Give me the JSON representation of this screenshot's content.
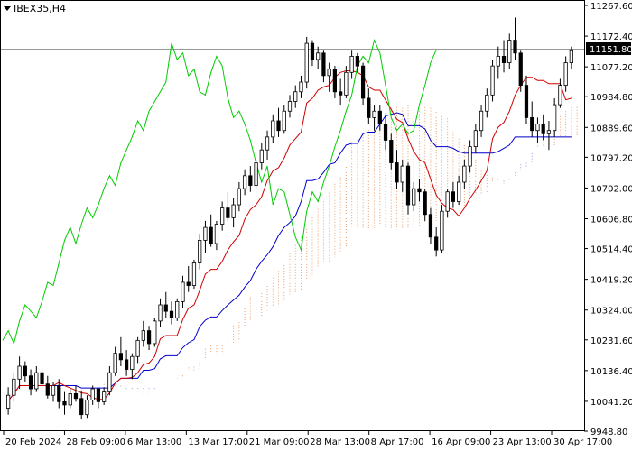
{
  "symbol": {
    "label": "IBEX35,H4"
  },
  "current_price_label": "11151.80",
  "chart_data": {
    "type": "candlestick",
    "title": "",
    "y_ticks": [
      "9948.80",
      "10041.20",
      "10136.40",
      "10231.60",
      "10324.00",
      "10419.20",
      "10514.40",
      "10606.80",
      "10702.00",
      "10797.20",
      "10889.60",
      "10984.80",
      "11077.20",
      "11172.40",
      "11267.60"
    ],
    "ylim": [
      9948.8,
      11267.6
    ],
    "x_ticks": [
      "20 Feb 2024",
      "28 Feb 09:00",
      "6 Mar 13:00",
      "13 Mar 17:00",
      "21 Mar 09:00",
      "28 Mar 13:00",
      "8 Apr 17:00",
      "16 Apr 09:00",
      "23 Apr 13:00",
      "30 Apr 17:00"
    ],
    "grid": false,
    "colors": {
      "bull": "#ffffff",
      "bear": "#000000",
      "wick": "#000000",
      "tenkan": "#d00000",
      "kijun": "#0000cc",
      "chikou": "#00cc00",
      "cloud_up": "#e8a070",
      "cloud_down": "#a0a0e0"
    },
    "candles": [
      [
        10020,
        10085,
        10000,
        10060
      ],
      [
        10060,
        10130,
        10040,
        10110
      ],
      [
        10110,
        10180,
        10080,
        10150
      ],
      [
        10150,
        10165,
        10100,
        10120
      ],
      [
        10120,
        10140,
        10060,
        10080
      ],
      [
        10080,
        10150,
        10070,
        10130
      ],
      [
        10130,
        10145,
        10080,
        10095
      ],
      [
        10095,
        10120,
        10050,
        10060
      ],
      [
        10060,
        10100,
        10040,
        10090
      ],
      [
        10090,
        10110,
        10020,
        10040
      ],
      [
        10040,
        10070,
        10000,
        10030
      ],
      [
        10030,
        10080,
        10020,
        10065
      ],
      [
        10065,
        10090,
        10040,
        10050
      ],
      [
        10050,
        10075,
        9985,
        10000
      ],
      [
        10000,
        10060,
        9990,
        10045
      ],
      [
        10045,
        10090,
        10030,
        10080
      ],
      [
        10080,
        10070,
        10020,
        10040
      ],
      [
        10040,
        10085,
        10030,
        10070
      ],
      [
        10070,
        10150,
        10060,
        10130
      ],
      [
        10130,
        10210,
        10120,
        10190
      ],
      [
        10190,
        10240,
        10150,
        10170
      ],
      [
        10170,
        10200,
        10120,
        10140
      ],
      [
        10140,
        10190,
        10110,
        10180
      ],
      [
        10180,
        10240,
        10160,
        10230
      ],
      [
        10230,
        10290,
        10210,
        10260
      ],
      [
        10260,
        10275,
        10200,
        10220
      ],
      [
        10220,
        10300,
        10210,
        10290
      ],
      [
        10290,
        10360,
        10270,
        10340
      ],
      [
        10340,
        10380,
        10300,
        10320
      ],
      [
        10320,
        10350,
        10280,
        10300
      ],
      [
        10300,
        10360,
        10290,
        10350
      ],
      [
        10350,
        10430,
        10330,
        10410
      ],
      [
        10410,
        10460,
        10380,
        10400
      ],
      [
        10400,
        10480,
        10390,
        10470
      ],
      [
        10470,
        10560,
        10450,
        10540
      ],
      [
        10540,
        10600,
        10500,
        10580
      ],
      [
        10580,
        10620,
        10520,
        10530
      ],
      [
        10530,
        10600,
        10510,
        10590
      ],
      [
        10590,
        10660,
        10570,
        10640
      ],
      [
        10640,
        10690,
        10600,
        10610
      ],
      [
        10610,
        10670,
        10580,
        10650
      ],
      [
        10650,
        10720,
        10630,
        10700
      ],
      [
        10700,
        10760,
        10680,
        10740
      ],
      [
        10740,
        10770,
        10690,
        10710
      ],
      [
        10710,
        10790,
        10700,
        10780
      ],
      [
        10780,
        10840,
        10760,
        10820
      ],
      [
        10820,
        10880,
        10790,
        10860
      ],
      [
        10860,
        10930,
        10840,
        10910
      ],
      [
        10910,
        10950,
        10860,
        10880
      ],
      [
        10880,
        10960,
        10870,
        10940
      ],
      [
        10940,
        10990,
        10920,
        10970
      ],
      [
        10970,
        11020,
        10950,
        11000
      ],
      [
        11000,
        11050,
        10980,
        11030
      ],
      [
        11030,
        11170,
        11010,
        11150
      ],
      [
        11150,
        11160,
        11080,
        11100
      ],
      [
        11100,
        11140,
        11070,
        11120
      ],
      [
        11120,
        11130,
        11030,
        11050
      ],
      [
        11050,
        11090,
        11000,
        11070
      ],
      [
        11070,
        11080,
        10980,
        11000
      ],
      [
        11000,
        11040,
        10960,
        10990
      ],
      [
        10990,
        11080,
        10980,
        11060
      ],
      [
        11060,
        11130,
        11040,
        11110
      ],
      [
        11110,
        11120,
        11060,
        11080
      ],
      [
        11080,
        11090,
        10960,
        10980
      ],
      [
        10980,
        11010,
        10900,
        10920
      ],
      [
        10920,
        10960,
        10880,
        10940
      ],
      [
        10940,
        10960,
        10880,
        10900
      ],
      [
        10900,
        10930,
        10820,
        10850
      ],
      [
        10850,
        10870,
        10760,
        10780
      ],
      [
        10780,
        10820,
        10700,
        10720
      ],
      [
        10720,
        10790,
        10690,
        10770
      ],
      [
        10770,
        10780,
        10620,
        10650
      ],
      [
        10650,
        10720,
        10630,
        10700
      ],
      [
        10700,
        10730,
        10660,
        10690
      ],
      [
        10690,
        10700,
        10600,
        10620
      ],
      [
        10620,
        10640,
        10530,
        10550
      ],
      [
        10550,
        10580,
        10490,
        10510
      ],
      [
        10510,
        10650,
        10500,
        10630
      ],
      [
        10630,
        10700,
        10610,
        10690
      ],
      [
        10690,
        10720,
        10640,
        10660
      ],
      [
        10660,
        10740,
        10650,
        10720
      ],
      [
        10720,
        10790,
        10700,
        10770
      ],
      [
        10770,
        10850,
        10750,
        10830
      ],
      [
        10830,
        10900,
        10810,
        10880
      ],
      [
        10880,
        10960,
        10860,
        10940
      ],
      [
        10940,
        11010,
        10920,
        10990
      ],
      [
        10990,
        11100,
        10970,
        11080
      ],
      [
        11080,
        11140,
        11040,
        11110
      ],
      [
        11110,
        11160,
        11060,
        11090
      ],
      [
        11090,
        11180,
        11070,
        11160
      ],
      [
        11160,
        11230,
        11100,
        11120
      ],
      [
        11120,
        11130,
        11000,
        11020
      ],
      [
        11020,
        11050,
        10900,
        10920
      ],
      [
        10920,
        10970,
        10860,
        10880
      ],
      [
        10880,
        10920,
        10840,
        10900
      ],
      [
        10900,
        10930,
        10850,
        10870
      ],
      [
        10870,
        10910,
        10820,
        10880
      ],
      [
        10880,
        10980,
        10860,
        10960
      ],
      [
        10960,
        11040,
        10950,
        11020
      ],
      [
        11020,
        11110,
        11000,
        11090
      ],
      [
        11090,
        11140,
        11070,
        11130
      ]
    ]
  }
}
